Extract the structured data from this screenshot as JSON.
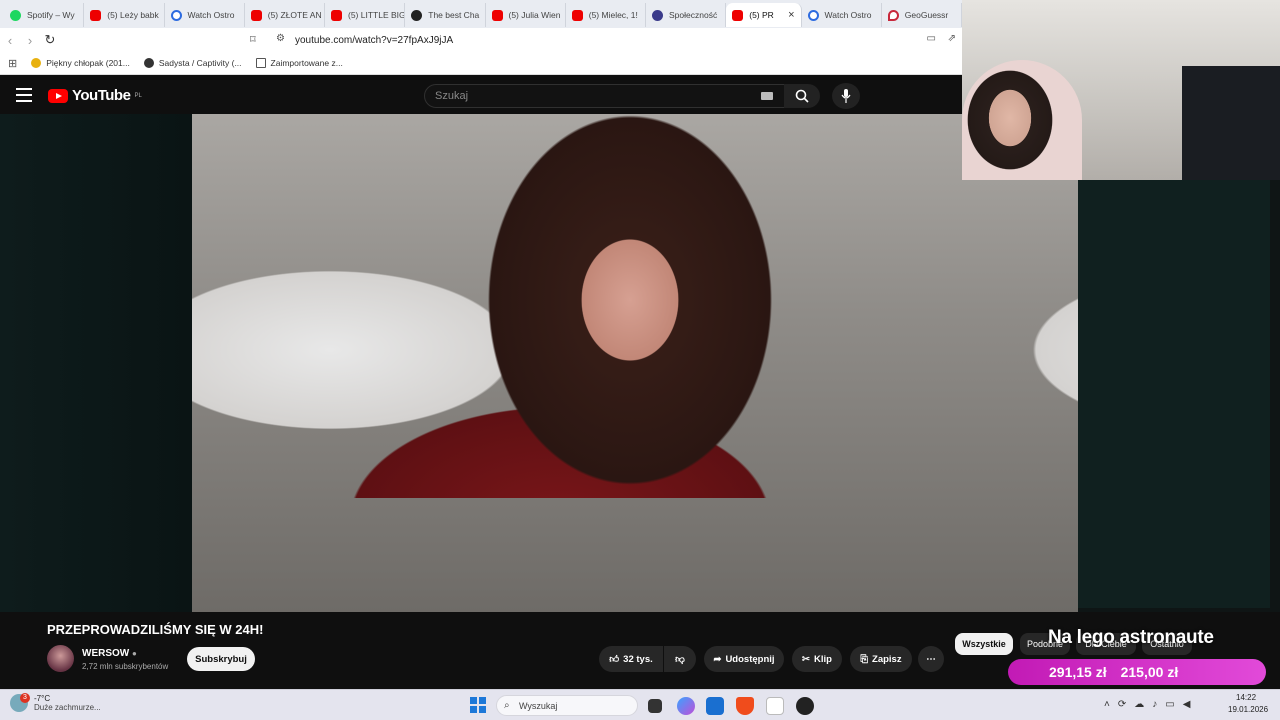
{
  "browser": {
    "tabs": [
      {
        "title": "Spotify – Wy",
        "icon": "spotify-icon"
      },
      {
        "title": "(5) Leży babk",
        "icon": "youtube-icon"
      },
      {
        "title": "Watch Ostro",
        "icon": "watch-icon"
      },
      {
        "title": "(5) ZŁOTE AN",
        "icon": "youtube-icon"
      },
      {
        "title": "(5) LITTLE BIG",
        "icon": "youtube-icon"
      },
      {
        "title": "The best Cha",
        "icon": "github-icon"
      },
      {
        "title": "(5) Julia Wien",
        "icon": "youtube-icon"
      },
      {
        "title": "(5) Mielec, 1!",
        "icon": "youtube-icon"
      },
      {
        "title": "Społeczność",
        "icon": "community-icon"
      },
      {
        "title": "(5) PR",
        "icon": "youtube-icon",
        "active": true
      },
      {
        "title": "Watch Ostro",
        "icon": "watch-icon"
      },
      {
        "title": "GeoGuessr",
        "icon": "geoguessr-icon"
      }
    ],
    "url": "youtube.com/watch?v=27fpAxJ9jJA",
    "bookmarks": [
      {
        "label": "Piękny chłopak (201..."
      },
      {
        "label": "Sadysta / Captivity (..."
      },
      {
        "label": "Zaimportowane z..."
      }
    ]
  },
  "youtube": {
    "logo_text": "YouTube",
    "region": "PL",
    "search_placeholder": "Szukaj",
    "video": {
      "title": "PRZEPROWADZILIŚMY SIĘ W 24H!",
      "channel": "WERSOW",
      "subscribers": "2,72 mln subskrybentów",
      "subscribe_label": "Subskrybuj",
      "likes": "32 tys.",
      "share_label": "Udostępnij",
      "clip_label": "Klip",
      "save_label": "Zapisz"
    },
    "chips": [
      "Wszystkie",
      "Podobne",
      "Dla Ciebie",
      "Ostatnio"
    ]
  },
  "stream_overlay": {
    "title": "Na lego astronaute",
    "amount_1": "291,15 zł",
    "amount_2": "215,00 zł"
  },
  "taskbar": {
    "weather_badge": "3",
    "temperature": "-7°C",
    "condition": "Duże zachmurze...",
    "search_placeholder": "Wyszukaj",
    "time": "14:22",
    "date": "19.01.2026"
  }
}
